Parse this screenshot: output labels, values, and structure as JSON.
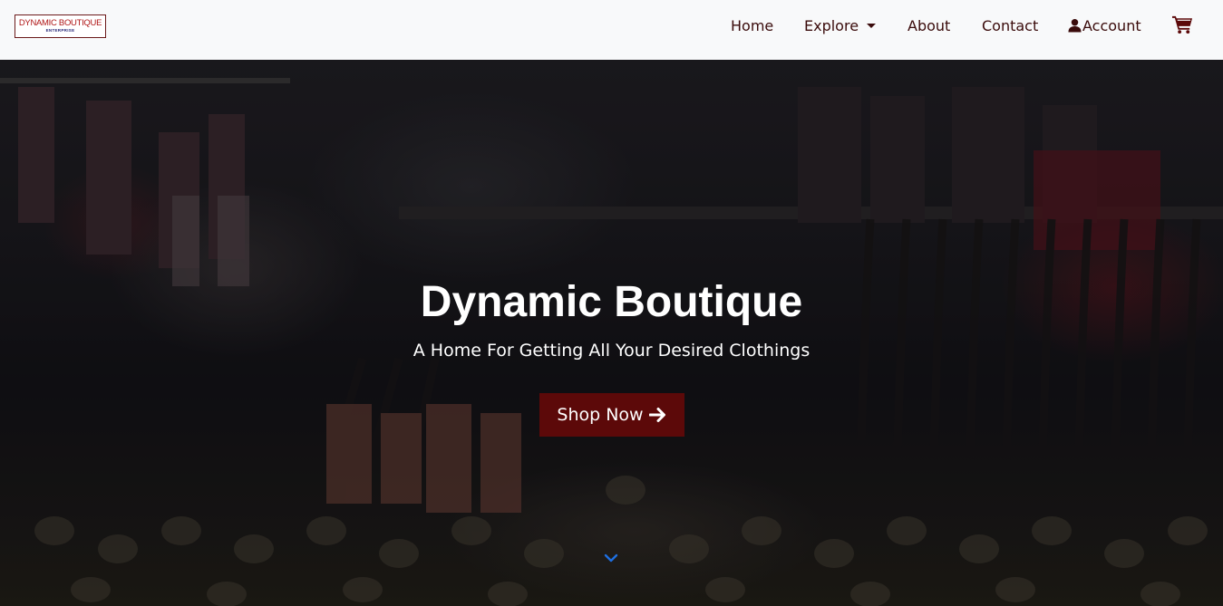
{
  "brand": {
    "name": "DYNAMIC BOUTIQUE",
    "subtitle": "ENTERPRISE"
  },
  "nav": {
    "items": [
      {
        "label": "Home"
      },
      {
        "label": "Explore",
        "has_dropdown": true
      },
      {
        "label": "About"
      },
      {
        "label": "Contact"
      },
      {
        "label": "Account",
        "icon": "user-icon"
      }
    ],
    "cart_icon": "shopping-cart-icon"
  },
  "hero": {
    "title": "Dynamic Boutique",
    "subtitle": "A Home For Getting All Your Desired Clothings",
    "cta_label": "Shop Now",
    "cta_icon": "arrow-right-icon",
    "scroll_icon": "chevron-down-icon"
  },
  "colors": {
    "primary": "#5c0909",
    "nav_text": "#3a0b0b",
    "nav_bg": "#f8f9fa",
    "scroll_indicator": "#1e6fe0"
  }
}
